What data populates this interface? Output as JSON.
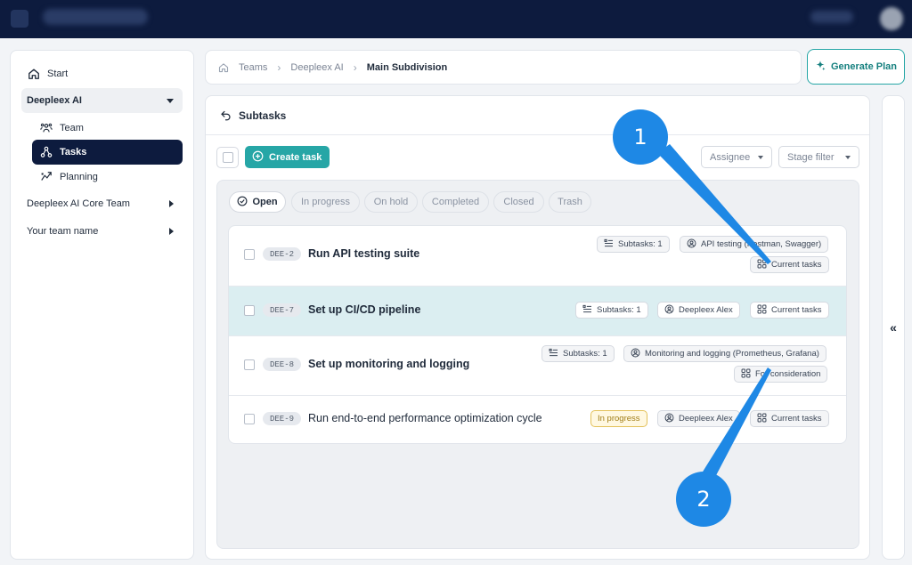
{
  "breadcrumb": {
    "items": [
      "Teams",
      "Deepleex AI"
    ],
    "current": "Main Subdivision"
  },
  "generate_plan": {
    "label": "Generate Plan"
  },
  "sidebar": {
    "start": "Start",
    "group": "Deepleex AI",
    "items": [
      {
        "label": "Team",
        "icon": "team-icon"
      },
      {
        "label": "Tasks",
        "icon": "tasks-icon",
        "active": true
      },
      {
        "label": "Planning",
        "icon": "planning-icon"
      }
    ],
    "other_teams": [
      "Deepleex AI Core Team",
      "Your team name"
    ]
  },
  "panel": {
    "title": "Subtasks",
    "create_task": "Create task",
    "filters": {
      "assignee": "Assignee",
      "stage": "Stage filter"
    },
    "tabs": [
      "Open",
      "In progress",
      "On hold",
      "Completed",
      "Closed",
      "Trash"
    ],
    "active_tab": "Open"
  },
  "tasks": [
    {
      "id": "DEE-2",
      "title": "Run API testing suite",
      "subtasks": "Subtasks: 1",
      "assignee": "API testing (Postman, Swagger)",
      "stage": "Current tasks"
    },
    {
      "id": "DEE-7",
      "title": "Set up CI/CD pipeline",
      "subtasks": "Subtasks: 1",
      "assignee": "Deepleex Alex",
      "stage": "Current tasks"
    },
    {
      "id": "DEE-8",
      "title": "Set up monitoring and logging",
      "subtasks": "Subtasks: 1",
      "assignee": "Monitoring and logging (Prometheus, Grafana)",
      "stage": "For consideration"
    },
    {
      "id": "DEE-9",
      "title": "Run end-to-end performance optimization cycle",
      "status": "In progress",
      "assignee": "Deepleex Alex",
      "stage": "Current tasks"
    }
  ],
  "callouts": [
    "1",
    "2"
  ],
  "collapse_toggle": "«",
  "colors": {
    "topbar": "#0d1b3e",
    "accent": "#26a6a6",
    "callout": "#1e88e5",
    "highlight_row": "#dbeef1"
  }
}
